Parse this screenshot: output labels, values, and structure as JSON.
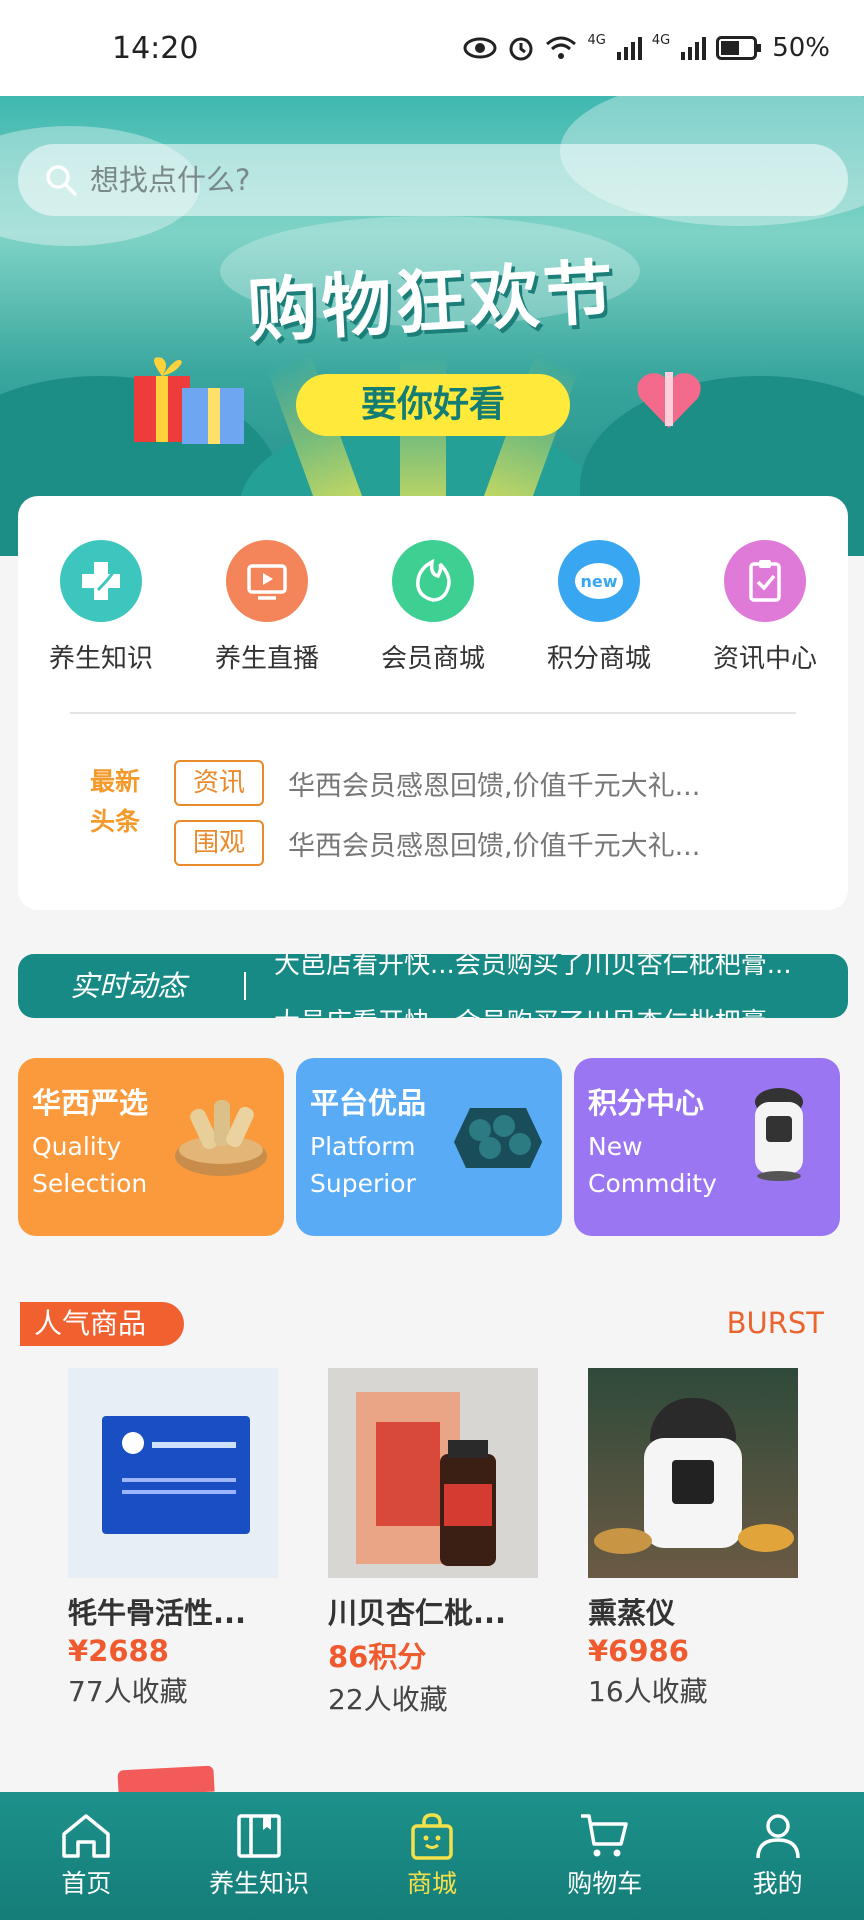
{
  "status": {
    "time": "14:20",
    "net1": "4G",
    "net2": "4G",
    "battery": "50%"
  },
  "search": {
    "placeholder": "想找点什么?"
  },
  "banner": {
    "title": "购物狂欢节",
    "pill": "要你好看"
  },
  "categories": [
    {
      "label": "养生知识",
      "icon": "health-cross-icon",
      "color": "#3dc6bd"
    },
    {
      "label": "养生直播",
      "icon": "live-play-icon",
      "color": "#f4845a"
    },
    {
      "label": "会员商城",
      "icon": "leaf-flame-icon",
      "color": "#3dd092"
    },
    {
      "label": "积分商城",
      "icon": "new-badge-icon",
      "color": "#39a6f2"
    },
    {
      "label": "资讯中心",
      "icon": "clipboard-check-icon",
      "color": "#e07ad8"
    }
  ],
  "news": {
    "logo_top": "最新",
    "logo_bottom": "头条",
    "items": [
      {
        "tag": "资讯",
        "text": "华西会员感恩回馈,价值千元大礼..."
      },
      {
        "tag": "围观",
        "text": "华西会员感恩回馈,价值千元大礼..."
      }
    ]
  },
  "ticker": {
    "label": "实时动态",
    "line1": "大邑店看开快...会员购买了川贝杏仁枇杷膏...",
    "line2": "大邑店看开快...会员购买了川贝杏仁枇杷膏..."
  },
  "features": [
    {
      "title": "华西严选",
      "sub1": "Quality",
      "sub2": "Selection",
      "color": "#fb9a3c"
    },
    {
      "title": "平台优品",
      "sub1": "Platform",
      "sub2": "Superior",
      "color": "#5aabf5"
    },
    {
      "title": "积分中心",
      "sub1": "New",
      "sub2": "Commdity",
      "color": "#9b76f2"
    }
  ],
  "popular": {
    "tag": "人气商品",
    "burst": "BURST",
    "products": [
      {
        "name": "牦牛骨活性...",
        "price": "¥2688",
        "fav": "77人收藏"
      },
      {
        "name": "川贝杏仁枇...",
        "price": "86积分",
        "fav": "22人收藏"
      },
      {
        "name": "熏蒸仪",
        "price": "¥6986",
        "fav": "16人收藏"
      }
    ]
  },
  "tabs": [
    {
      "label": "首页",
      "icon": "home-icon"
    },
    {
      "label": "养生知识",
      "icon": "book-icon"
    },
    {
      "label": "商城",
      "icon": "shopping-bag-icon"
    },
    {
      "label": "购物车",
      "icon": "cart-icon"
    },
    {
      "label": "我的",
      "icon": "user-icon"
    }
  ],
  "colors": {
    "accent": "#178a85",
    "active_tab": "#f4e14a",
    "price": "#ef5a2f"
  }
}
